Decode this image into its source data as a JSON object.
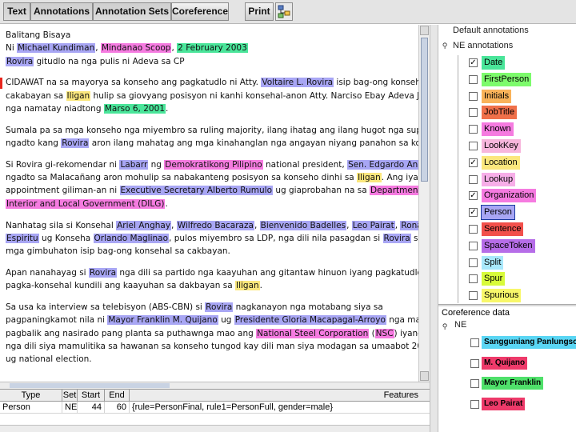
{
  "toolbar": {
    "buttons": [
      {
        "label": "Text",
        "active": true
      },
      {
        "label": "Annotations",
        "active": true
      },
      {
        "label": "Annotation Sets",
        "active": true
      },
      {
        "label": "Coreference",
        "active": false
      }
    ],
    "print_label": "Print",
    "tool_icon": "tree-view-icon"
  },
  "document": {
    "paragraphs": [
      [
        [
          {
            "t": "Balitang Bisaya"
          }
        ],
        [
          {
            "t": "Ni "
          },
          {
            "t": "Michael Kundiman",
            "c": "#a8a6f4"
          },
          {
            "t": ", "
          },
          {
            "t": "Mindanao Scoop",
            "c": "#f57be0"
          },
          {
            "t": ", "
          },
          {
            "t": "2 February 2003",
            "c": "#4ae59a"
          }
        ],
        [
          {
            "t": "Rovira",
            "c": "#a8a6f4"
          },
          {
            "t": " gitudlo na nga pulis ni Adeva sa CP"
          }
        ]
      ],
      [
        [
          {
            "t": "CIDAWAT na sa mayorya sa konseho ang pagkatudlo ni Atty. "
          },
          {
            "t": "Voltaire L. Rovira",
            "c": "#a8a6f4"
          },
          {
            "t": " isip bag-ong konsehal sa"
          }
        ],
        [
          {
            "t": "cakabayan sa "
          },
          {
            "t": "Iligan",
            "c": "#fbe77d"
          },
          {
            "t": " hulip sa giovyang posisyon ni kanhi konsehal-anon Atty. Narciso Ebay Adeva Jr."
          }
        ],
        [
          {
            "t": "nga namatay niadtong "
          },
          {
            "t": "Marso 6, 2001",
            "c": "#4ae59a"
          },
          {
            "t": "."
          }
        ]
      ],
      [
        [
          {
            "t": "Sumala pa sa mga konseho nga miyembro sa ruling majority, ilang ihatag ang ilang hugot nga suporta"
          }
        ],
        [
          {
            "t": "ngadto kang "
          },
          {
            "t": "Rovira",
            "c": "#a8a6f4"
          },
          {
            "t": " aron ilang mahatag ang mga kinahanglan nga angayan niyang panahon sa konseho."
          }
        ]
      ],
      [
        [
          {
            "t": "Si Rovira gi-rekomendar ni "
          },
          {
            "t": "Labarr",
            "c": "#a8a6f4"
          },
          {
            "t": " ng "
          },
          {
            "t": "Demokratikong Pilipino",
            "c": "#f57be0"
          },
          {
            "t": " national president, "
          },
          {
            "t": "Sen. Edgardo Angara",
            "c": "#a8a6f4"
          },
          {
            "t": ","
          }
        ],
        [
          {
            "t": "ngadto sa Malacañang aron mohulip sa nabakanteng posisyon sa konseho dinhi sa "
          },
          {
            "t": "Iligan",
            "c": "#fbe77d"
          },
          {
            "t": ". Ang iyang"
          }
        ],
        [
          {
            "t": "appointment giliman-an ni "
          },
          {
            "t": "Executive Secretary Alberto Rumulo",
            "c": "#a8a6f4"
          },
          {
            "t": " ug giaprobahan na sa "
          },
          {
            "t": "Department of",
            "c": "#f57be0"
          }
        ],
        [
          {
            "t": "Interior and Local Government (DILG)",
            "c": "#f57be0"
          },
          {
            "t": "."
          }
        ]
      ],
      [
        [
          {
            "t": "Nanhatag sila si Konsehal "
          },
          {
            "t": "Ariel Anghay",
            "c": "#a8a6f4"
          },
          {
            "t": ", "
          },
          {
            "t": "Wilfredo Bacaraza",
            "c": "#a8a6f4"
          },
          {
            "t": ", "
          },
          {
            "t": "Bienvenido Badelles",
            "c": "#a8a6f4"
          },
          {
            "t": ", "
          },
          {
            "t": "Leo Pairat",
            "c": "#a8a6f4"
          },
          {
            "t": ", "
          },
          {
            "t": "Ronaldo",
            "c": "#a8a6f4"
          }
        ],
        [
          {
            "t": "Espiritu",
            "c": "#a8a6f4"
          },
          {
            "t": " ug Konseha "
          },
          {
            "t": "Orlando Maglinao",
            "c": "#a8a6f4"
          },
          {
            "t": ", pulos miyembro sa LDP, nga dili nila pasagdan si "
          },
          {
            "t": "Rovira",
            "c": "#a8a6f4"
          },
          {
            "t": " sa iyang"
          }
        ],
        [
          {
            "t": "mga gimbuhaton isip bag-ong konsehal sa cakbayan."
          }
        ]
      ],
      [
        [
          {
            "t": "Apan nanahayag si "
          },
          {
            "t": "Rovira",
            "c": "#a8a6f4"
          },
          {
            "t": " nga dili sa partido nga kaayuhan ang gitantaw hinuon iyang pagkatudlo"
          }
        ],
        [
          {
            "t": "pagka-konsehal kundili ang kaayuhan sa dakbayan sa "
          },
          {
            "t": "Iligan",
            "c": "#fbe77d"
          },
          {
            "t": "."
          }
        ]
      ],
      [
        [
          {
            "t": "Sa usa ka interview sa telebisyon (ABS-CBN) si "
          },
          {
            "t": "Rovira",
            "c": "#a8a6f4"
          },
          {
            "t": " nagkanayon nga motabang siya sa"
          }
        ],
        [
          {
            "t": "pagpaningkamot nila ni "
          },
          {
            "t": "Mayor Franklin M. Quijano",
            "c": "#a8a6f4"
          },
          {
            "t": " ug "
          },
          {
            "t": "Presidente Gloria Macapagal-Arroyo",
            "c": "#a8a6f4"
          },
          {
            "t": " nga mahuksan"
          }
        ],
        [
          {
            "t": "pagbalik ang nasirado pang planta sa puthawnga mao ang "
          },
          {
            "t": "National Steel Corporation",
            "c": "#f57be0"
          },
          {
            "t": " ("
          },
          {
            "t": "NSC",
            "c": "#f57be0"
          },
          {
            "t": ") iyang gikaron"
          }
        ],
        [
          {
            "t": "nga dili siya mamulitika sa hawanan sa konseho tungod kay dili man siya modagan sa umaabot 2004 local"
          }
        ],
        [
          {
            "t": "ug national election."
          }
        ]
      ]
    ]
  },
  "table": {
    "headers": [
      "Type",
      "Set",
      "Start",
      "End",
      "Features"
    ],
    "rows": [
      [
        "Person",
        "NE",
        "44",
        "60",
        "{rule=PersonFinal, rule1=PersonFull, gender=male}"
      ]
    ]
  },
  "annotation_tree": {
    "default_label": "Default annotations",
    "set_label": "NE annotations",
    "types": [
      {
        "label": "Date",
        "checked": true,
        "color": "#4ae59a",
        "selected": false
      },
      {
        "label": "FirstPerson",
        "checked": false,
        "color": "#7dfb6c",
        "selected": false
      },
      {
        "label": "Initials",
        "checked": false,
        "color": "#f9b35a",
        "selected": false
      },
      {
        "label": "JobTitle",
        "checked": false,
        "color": "#f0704a",
        "selected": false
      },
      {
        "label": "Known",
        "checked": false,
        "color": "#f57be0",
        "selected": false
      },
      {
        "label": "LookKey",
        "checked": false,
        "color": "#f7b6dc",
        "selected": false
      },
      {
        "label": "Location",
        "checked": true,
        "color": "#fbe77d",
        "selected": false
      },
      {
        "label": "Lookup",
        "checked": false,
        "color": "#f7aee8",
        "selected": false
      },
      {
        "label": "Organization",
        "checked": true,
        "color": "#f57be0",
        "selected": false
      },
      {
        "label": "Person",
        "checked": true,
        "color": "#a8a6f4",
        "selected": true
      },
      {
        "label": "Sentence",
        "checked": false,
        "color": "#f2504b",
        "selected": false
      },
      {
        "label": "SpaceToken",
        "checked": false,
        "color": "#b66de8",
        "selected": false
      },
      {
        "label": "Split",
        "checked": false,
        "color": "#a8e8fb",
        "selected": false
      },
      {
        "label": "Spur",
        "checked": false,
        "color": "#d8fb3a",
        "selected": false
      },
      {
        "label": "Spurious",
        "checked": false,
        "color": "#f8f76a",
        "selected": false
      }
    ]
  },
  "coreference": {
    "title": "Coreference data",
    "set_label": "NE",
    "chains": [
      {
        "label": "Sangguniang Panlungsod",
        "color": "#5ad6f4"
      },
      {
        "label": "M. Quijano",
        "color": "#ee3a6a"
      },
      {
        "label": "Mayor Franklin",
        "color": "#4fe06a"
      },
      {
        "label": "Leo Pairat",
        "color": "#ee3a6a"
      }
    ]
  }
}
